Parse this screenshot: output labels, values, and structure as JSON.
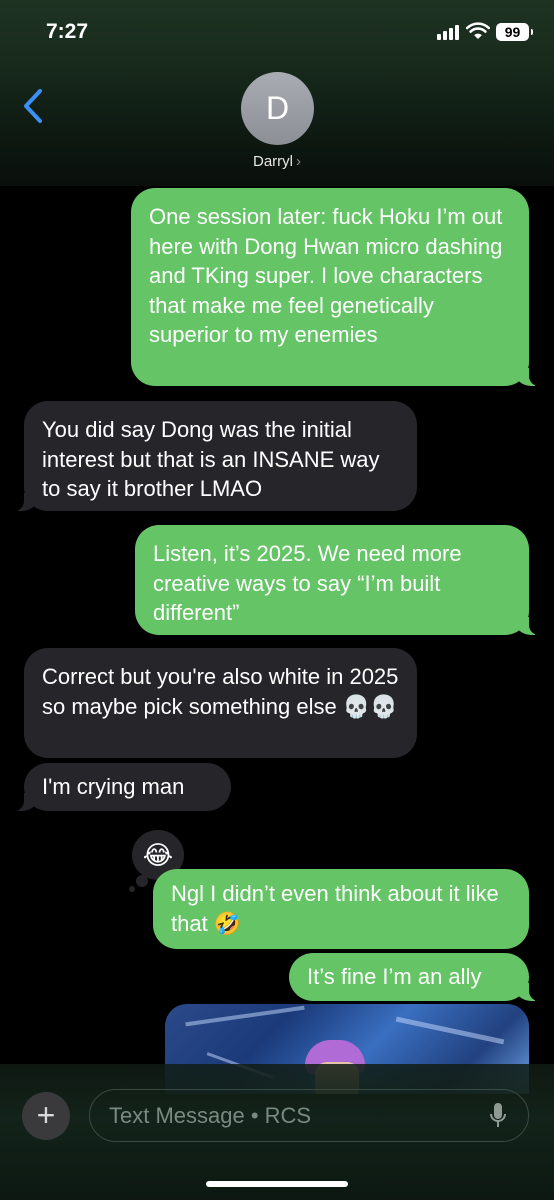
{
  "status_bar": {
    "time": "7:27",
    "battery": "99"
  },
  "contact": {
    "initial": "D",
    "name": "Darryl",
    "chevron": "›"
  },
  "messages": [
    {
      "from": "me",
      "text": "One session later: fuck Hoku I’m out here with Dong Hwan micro dashing and TKing super. I love characters that make me feel genetically superior to my enemies"
    },
    {
      "from": "them",
      "text": "You did say Dong was the initial interest but that is an INSANE way to say it brother LMAO"
    },
    {
      "from": "me",
      "text": "Listen, it’s 2025. We need more creative ways to say “I’m built different”"
    },
    {
      "from": "them",
      "text": "Correct but you're also white in 2025 so maybe pick something else 💀💀"
    },
    {
      "from": "them",
      "text": "I'm crying man"
    },
    {
      "from": "me",
      "text": "Ngl I didn’t even think about it like that 🤣"
    },
    {
      "from": "me",
      "text": "It’s fine I’m an ally"
    }
  ],
  "tapback": {
    "emoji": "😂"
  },
  "compose": {
    "placeholder": "Text Message • RCS",
    "plus_label": "+"
  },
  "icons": {
    "back": "chevron-left-icon",
    "signal": "cellular-signal-icon",
    "wifi": "wifi-icon",
    "battery": "battery-icon",
    "plus": "plus-icon",
    "mic": "microphone-icon"
  },
  "colors": {
    "sent_bubble": "#65c466",
    "received_bubble": "#26252a",
    "back_accent": "#3b8ff5"
  }
}
